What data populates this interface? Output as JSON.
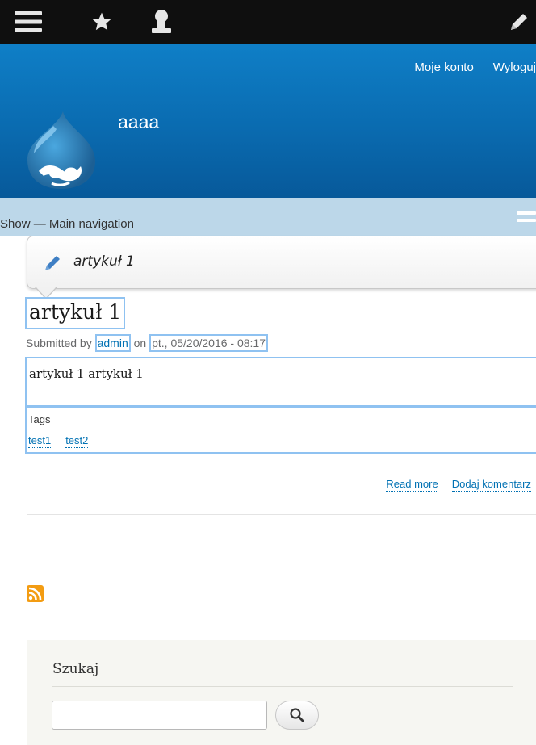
{
  "toolbar": {
    "icons": [
      "menu-icon",
      "star-icon",
      "user-icon",
      "pencil-icon"
    ]
  },
  "header": {
    "secondary_menu": [
      "Moje konto",
      "Wyloguj"
    ],
    "site_name": "aaaa",
    "brand_color": "#0a6bb0"
  },
  "navigation": {
    "label": "Show — Main navigation"
  },
  "contextual_popup": {
    "title": "artykuł 1"
  },
  "article": {
    "title": "artykuł 1",
    "submitted_prefix": "Submitted by",
    "author": "admin",
    "on_word": "on",
    "date": "pt., 05/20/2016 - 08:17",
    "body": "artykuł 1 artykuł 1",
    "tags_label": "Tags",
    "tags": [
      "test1",
      "test2"
    ],
    "links": [
      "Read more",
      "Dodaj komentarz"
    ]
  },
  "search": {
    "title": "Szukaj",
    "input_value": "",
    "button_icon": "search-icon"
  },
  "colors": {
    "toolbar_bg": "#0f0f0f",
    "nav_bg": "#bcd7e9",
    "link": "#0071b3",
    "outline": "#8fc2f1",
    "feed": "#f39c12"
  }
}
